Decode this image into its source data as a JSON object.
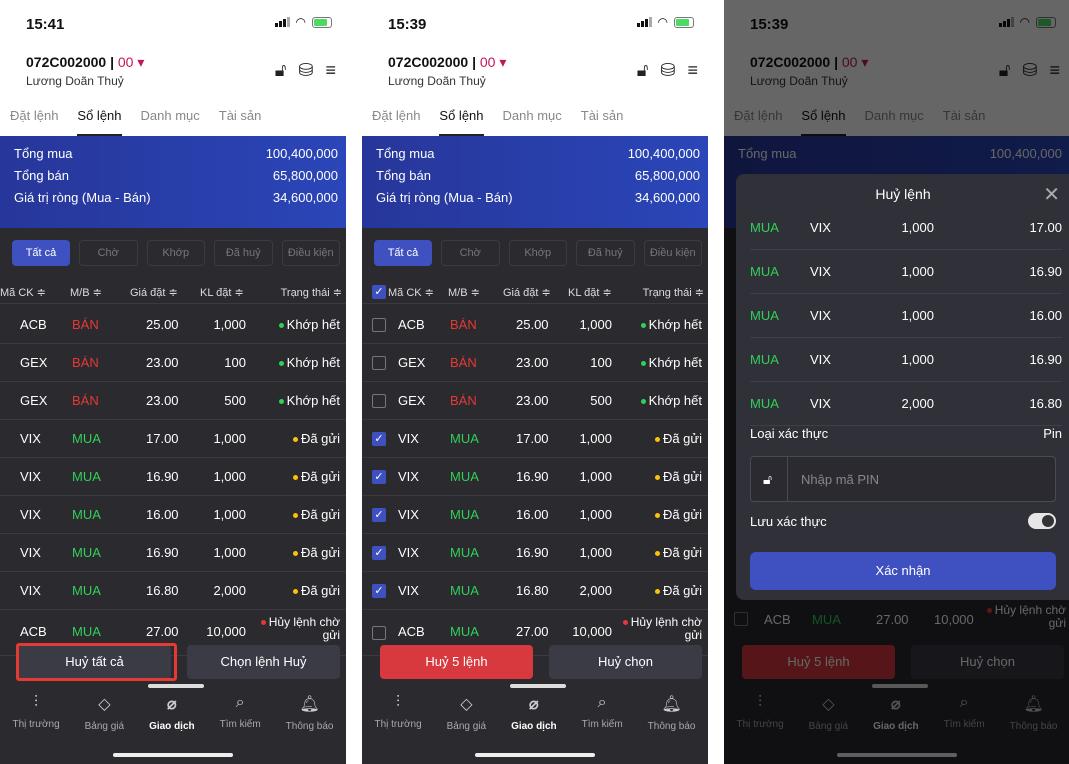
{
  "screens": [
    {
      "time": "15:41",
      "account": "072C002000",
      "sub_account": "00",
      "user_name": "Lương Doãn Thuỷ",
      "tabs": [
        "Đặt lệnh",
        "Sổ lệnh",
        "Danh mục",
        "Tài sản"
      ],
      "active_tab": "Sổ lệnh",
      "summary": [
        {
          "label": "Tổng mua",
          "value": "100,400,000"
        },
        {
          "label": "Tổng bán",
          "value": "65,800,000"
        },
        {
          "label": "Giá trị ròng (Mua - Bán)",
          "value": "34,600,000"
        }
      ],
      "filters": [
        "Tất cả",
        "Chờ",
        "Khớp",
        "Đã huỷ",
        "Điều kiện"
      ],
      "columns": [
        "Mã CK ≑",
        "M/B ≑",
        "Giá đặt ≑",
        "KL đặt ≑",
        "Trạng thái ≑"
      ],
      "actions": [
        "Huỷ tất cả",
        "Chọn lệnh Huỷ"
      ],
      "highlight_action": "Huỷ tất cả"
    },
    {
      "time": "15:39",
      "account": "072C002000",
      "sub_account": "00",
      "user_name": "Lương Doãn Thuỷ",
      "tabs": [
        "Đặt lệnh",
        "Sổ lệnh",
        "Danh mục",
        "Tài sản"
      ],
      "active_tab": "Sổ lệnh",
      "summary": [
        {
          "label": "Tổng mua",
          "value": "100,400,000"
        },
        {
          "label": "Tổng bán",
          "value": "65,800,000"
        },
        {
          "label": "Giá trị ròng (Mua - Bán)",
          "value": "34,600,000"
        }
      ],
      "filters": [
        "Tất cả",
        "Chờ",
        "Khớp",
        "Đã huỷ",
        "Điều kiện"
      ],
      "columns": [
        "Mã CK ≑",
        "M/B ≑",
        "Giá đặt ≑",
        "KL đặt ≑",
        "Trạng thái ≑"
      ],
      "checked": [
        false,
        false,
        false,
        true,
        true,
        true,
        true,
        true,
        false
      ],
      "actions": [
        "Huỷ 5 lệnh",
        "Huỷ chọn"
      ]
    },
    {
      "time": "15:39",
      "account": "072C002000",
      "sub_account": "00",
      "user_name": "Lương Doãn Thuỷ",
      "tabs": [
        "Đặt lệnh",
        "Sổ lệnh",
        "Danh mục",
        "Tài sản"
      ],
      "summary_first": {
        "label": "Tổng mua",
        "value": "100,400,000"
      },
      "background_row": {
        "symbol": "ACB",
        "side": "MUA",
        "price": "27.00",
        "qty": "10,000",
        "status": "Hủy lệnh chờ gửi"
      },
      "actions": [
        "Huỷ 5 lệnh",
        "Huỷ chọn"
      ],
      "modal": {
        "title": "Huỷ lệnh",
        "orders": [
          {
            "side": "MUA",
            "symbol": "VIX",
            "qty": "1,000",
            "price": "17.00"
          },
          {
            "side": "MUA",
            "symbol": "VIX",
            "qty": "1,000",
            "price": "16.90"
          },
          {
            "side": "MUA",
            "symbol": "VIX",
            "qty": "1,000",
            "price": "16.00"
          },
          {
            "side": "MUA",
            "symbol": "VIX",
            "qty": "1,000",
            "price": "16.90"
          },
          {
            "side": "MUA",
            "symbol": "VIX",
            "qty": "2,000",
            "price": "16.80"
          }
        ],
        "auth_label": "Loại xác thực",
        "auth_value": "Pin",
        "pin_placeholder": "Nhập mã PIN",
        "save_auth_label": "Lưu xác thực",
        "save_auth_on": false,
        "confirm_label": "Xác nhận"
      }
    }
  ],
  "orders": [
    {
      "symbol": "ACB",
      "side": "BÁN",
      "price": "25.00",
      "qty": "1,000",
      "status": "Khớp hết",
      "status_color": "green"
    },
    {
      "symbol": "GEX",
      "side": "BÁN",
      "price": "23.00",
      "qty": "100",
      "status": "Khớp hết",
      "status_color": "green"
    },
    {
      "symbol": "GEX",
      "side": "BÁN",
      "price": "23.00",
      "qty": "500",
      "status": "Khớp hết",
      "status_color": "green"
    },
    {
      "symbol": "VIX",
      "side": "MUA",
      "price": "17.00",
      "qty": "1,000",
      "status": "Đã gửi",
      "status_color": "yellow"
    },
    {
      "symbol": "VIX",
      "side": "MUA",
      "price": "16.90",
      "qty": "1,000",
      "status": "Đã gửi",
      "status_color": "yellow"
    },
    {
      "symbol": "VIX",
      "side": "MUA",
      "price": "16.00",
      "qty": "1,000",
      "status": "Đã gửi",
      "status_color": "yellow"
    },
    {
      "symbol": "VIX",
      "side": "MUA",
      "price": "16.90",
      "qty": "1,000",
      "status": "Đã gửi",
      "status_color": "yellow"
    },
    {
      "symbol": "VIX",
      "side": "MUA",
      "price": "16.80",
      "qty": "2,000",
      "status": "Đã gửi",
      "status_color": "yellow"
    },
    {
      "symbol": "ACB",
      "side": "MUA",
      "price": "27.00",
      "qty": "10,000",
      "status": "Hủy lệnh chờ gửi",
      "status_color": "red"
    }
  ],
  "nav": [
    {
      "label": "Thị trường",
      "icon": "chart-icon"
    },
    {
      "label": "Bảng giá",
      "icon": "tag-icon"
    },
    {
      "label": "Giao dịch",
      "icon": "trade-icon"
    },
    {
      "label": "Tìm kiếm",
      "icon": "search-icon"
    },
    {
      "label": "Thông báo",
      "icon": "bell-icon"
    }
  ],
  "active_nav": "Giao dịch",
  "colors": {
    "buy": "#2fd158",
    "sell": "#e53935",
    "accent": "#3f51c0",
    "danger": "#d8393f"
  }
}
